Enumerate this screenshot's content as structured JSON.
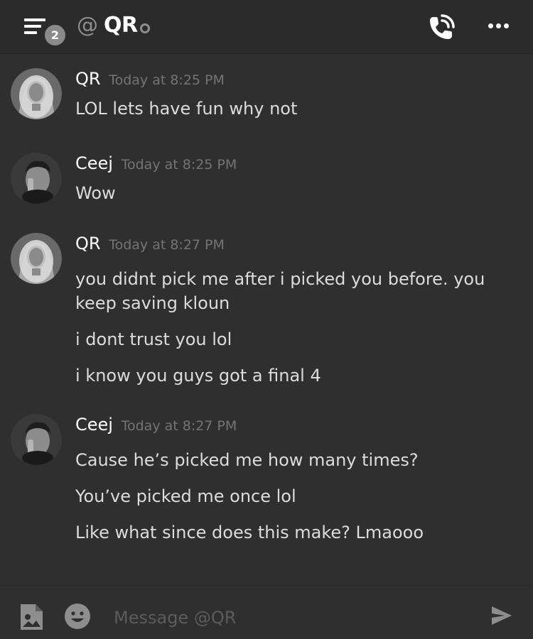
{
  "header": {
    "unread_badge": "2",
    "at_symbol": "@",
    "channel_name": "QR"
  },
  "icons": {
    "menu": "hamburger-menu-icon",
    "call": "phone-call-icon",
    "more": "more-dots-icon",
    "status": "offline-status-icon",
    "image": "image-upload-icon",
    "emoji": "emoji-icon",
    "send": "send-icon"
  },
  "colors": {
    "background": "#2f2f2f",
    "header_background": "#2b2b2b",
    "author": "#ffffff",
    "text": "#dcdcdc",
    "timestamp": "#747474",
    "badge": "#8a8a8a"
  },
  "messages": [
    {
      "author": "QR",
      "timestamp": "Today at 8:25 PM",
      "lines": [
        "LOL lets have fun why not"
      ]
    },
    {
      "author": "Ceej",
      "timestamp": "Today at 8:25 PM",
      "lines": [
        "Wow"
      ]
    },
    {
      "author": "QR",
      "timestamp": "Today at 8:27 PM",
      "lines": [
        "you didnt pick me after i picked you before. you keep saving kloun",
        "i dont trust you lol",
        "i know you guys got a final 4"
      ]
    },
    {
      "author": "Ceej",
      "timestamp": "Today at 8:27 PM",
      "lines": [
        "Cause he’s picked me how many times?",
        "You’ve picked me once lol",
        "Like what since does this make? Lmaooo"
      ]
    }
  ],
  "composer": {
    "placeholder": "Message @QR"
  }
}
